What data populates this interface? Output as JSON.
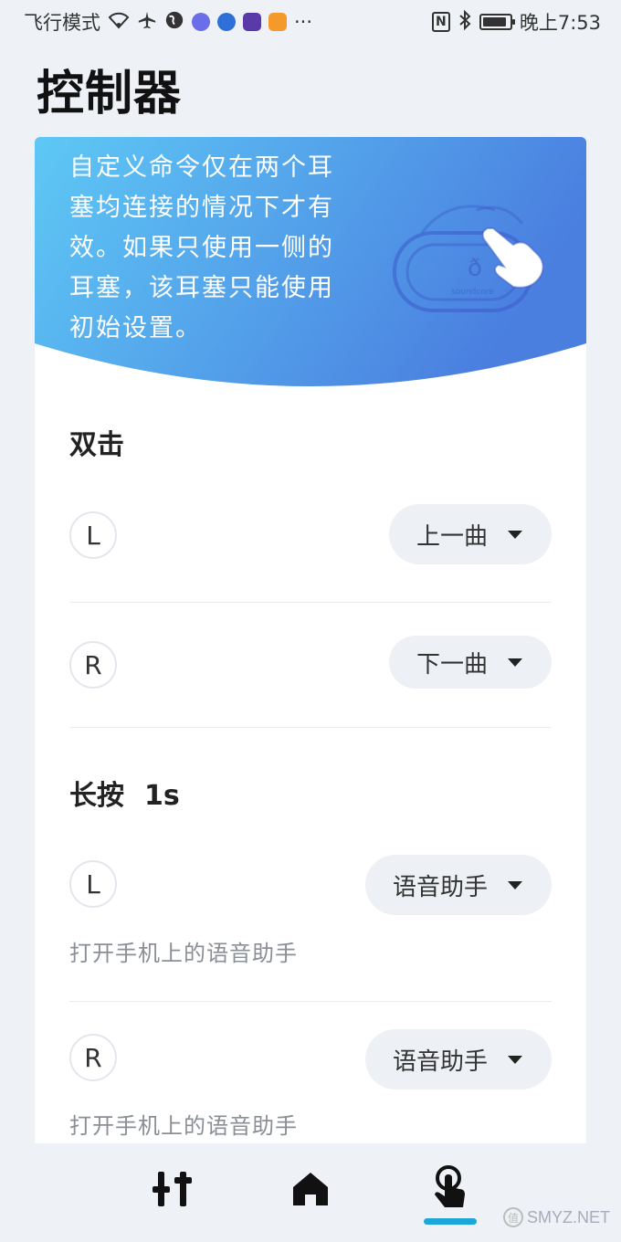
{
  "status_bar": {
    "left_text": "飞行模式",
    "time": "晚上7:53",
    "icons": [
      "wifi-icon",
      "airplane-icon",
      "earth-icon",
      "music-app-icon",
      "baidu-icon",
      "browser-app-icon",
      "video-app-icon",
      "more-icon",
      "nfc-icon",
      "bluetooth-icon",
      "battery-icon"
    ],
    "more_glyph": "···",
    "nfc_glyph": "N"
  },
  "page": {
    "title": "控制器"
  },
  "banner": {
    "text": "自定义命令仅在两个耳塞均连接的情况下才有效。如果只使用一侧的耳塞，该耳塞只能使用初始设置。",
    "brand": "soundcore",
    "gradient_start": "#5ec8f5",
    "gradient_end": "#4a7fe0"
  },
  "sections": {
    "double_tap": {
      "title": "双击",
      "left": {
        "side": "L",
        "action": "上一曲"
      },
      "right": {
        "side": "R",
        "action": "下一曲"
      }
    },
    "long_press": {
      "title": "长按",
      "duration": "1s",
      "left": {
        "side": "L",
        "action": "语音助手",
        "hint": "打开手机上的语音助手"
      },
      "right": {
        "side": "R",
        "action": "语音助手",
        "hint": "打开手机上的语音助手"
      }
    }
  },
  "bottom_nav": {
    "items": [
      "equalizer-icon",
      "home-icon",
      "touch-control-icon"
    ],
    "active_index": 2,
    "accent": "#1fa6d8"
  },
  "watermark": {
    "text": "SMYZ.NET",
    "badge": "值"
  }
}
